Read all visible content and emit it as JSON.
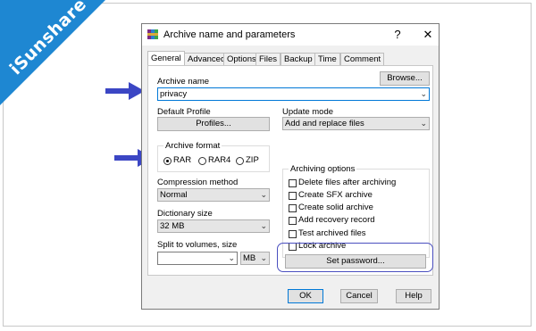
{
  "brand": {
    "name": "iSunshare",
    "ribbon_color": "#1e87d2"
  },
  "dialog": {
    "title": "Archive name and parameters",
    "help_glyph": "?",
    "close_glyph": "✕",
    "tabs": [
      "General",
      "Advanced",
      "Options",
      "Files",
      "Backup",
      "Time",
      "Comment"
    ],
    "active_tab": "General",
    "archive_name": {
      "label": "Archive name",
      "value": "privacy",
      "browse_label": "Browse..."
    },
    "default_profile": {
      "label": "Default Profile",
      "button_label": "Profiles..."
    },
    "update_mode": {
      "label": "Update mode",
      "value": "Add and replace files"
    },
    "archive_format": {
      "label": "Archive format",
      "options": [
        "RAR",
        "RAR4",
        "ZIP"
      ],
      "selected": "RAR"
    },
    "compression_method": {
      "label": "Compression method",
      "value": "Normal"
    },
    "dictionary_size": {
      "label": "Dictionary size",
      "value": "32 MB"
    },
    "split_volumes": {
      "label": "Split to volumes, size",
      "value": "",
      "unit": "MB"
    },
    "archiving_options": {
      "label": "Archiving options",
      "items": [
        "Delete files after archiving",
        "Create SFX archive",
        "Create solid archive",
        "Add recovery record",
        "Test archived files",
        "Lock archive"
      ]
    },
    "set_password_label": "Set password...",
    "footer": {
      "ok": "OK",
      "cancel": "Cancel",
      "help": "Help"
    }
  },
  "highlight_color": "#4a4fbf",
  "arrow_color": "#3b46c4"
}
